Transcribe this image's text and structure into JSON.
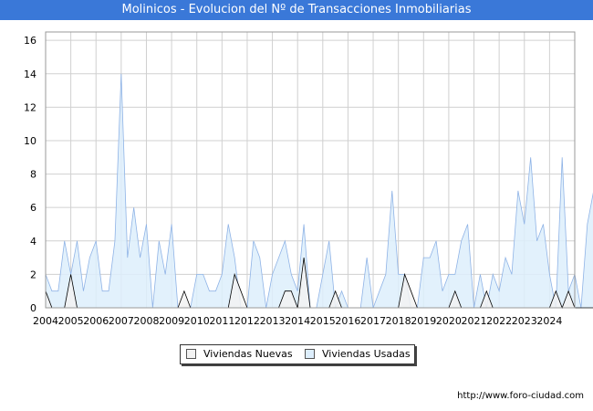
{
  "header": {
    "title": "Molinicos - Evolucion del Nº de Transacciones Inmobiliarias"
  },
  "footer": {
    "url": "http://www.foro-ciudad.com"
  },
  "colors": {
    "title_bar": "#3a78d8",
    "usadas_fill": "#ddeefc",
    "usadas_line": "#8fb3e6",
    "nuevas_fill": "#f2f2f2",
    "nuevas_line": "#000000",
    "grid": "#d0d0d0"
  },
  "chart_data": {
    "type": "area",
    "title": "Molinicos - Evolucion del Nº de Transacciones Inmobiliarias",
    "xlabel": "",
    "ylabel": "",
    "ylim": [
      0,
      16.5
    ],
    "yticks": [
      "0",
      "2",
      "4",
      "6",
      "8",
      "10",
      "12",
      "14",
      "16"
    ],
    "xticks": [
      "2004",
      "2005",
      "2006",
      "2007",
      "2008",
      "2009",
      "2010",
      "2011",
      "2012",
      "2013",
      "2014",
      "2015",
      "2016",
      "2017",
      "2018",
      "2019",
      "2020",
      "2021",
      "2022",
      "2023",
      "2024"
    ],
    "x_start": 2004,
    "points_per_year": 4,
    "grid": true,
    "legend_position": "bottom",
    "series": [
      {
        "name": "Viviendas Nuevas",
        "values": [
          1,
          0,
          0,
          0,
          2,
          0,
          0,
          0,
          0,
          0,
          0,
          0,
          0,
          0,
          0,
          0,
          0,
          0,
          0,
          0,
          0,
          0,
          1,
          0,
          0,
          0,
          0,
          0,
          0,
          0,
          2,
          1,
          0,
          0,
          0,
          0,
          0,
          0,
          1,
          1,
          0,
          3,
          0,
          0,
          0,
          0,
          1,
          0,
          0,
          0,
          0,
          0,
          0,
          0,
          0,
          0,
          0,
          2,
          1,
          0,
          0,
          0,
          0,
          0,
          0,
          1,
          0,
          0,
          0,
          0,
          1,
          0,
          0,
          0,
          0,
          0,
          0,
          0,
          0,
          0,
          0,
          1,
          0,
          1,
          0,
          0,
          0,
          0,
          0,
          0,
          0,
          0,
          0
        ]
      },
      {
        "name": "Viviendas Usadas",
        "values": [
          2,
          1,
          1,
          4,
          2,
          4,
          1,
          3,
          4,
          1,
          1,
          4,
          14,
          3,
          6,
          3,
          5,
          0,
          4,
          2,
          5,
          0,
          0,
          0,
          2,
          2,
          1,
          1,
          2,
          5,
          3,
          0,
          0,
          4,
          3,
          0,
          2,
          3,
          4,
          2,
          1,
          5,
          0,
          0,
          2,
          4,
          0,
          1,
          0,
          0,
          0,
          3,
          0,
          1,
          2,
          7,
          2,
          2,
          0,
          0,
          3,
          3,
          4,
          1,
          2,
          2,
          4,
          5,
          0,
          2,
          0,
          2,
          1,
          3,
          2,
          7,
          5,
          9,
          4,
          5,
          2,
          0,
          9,
          1,
          2,
          0,
          5,
          7
        ]
      }
    ]
  }
}
